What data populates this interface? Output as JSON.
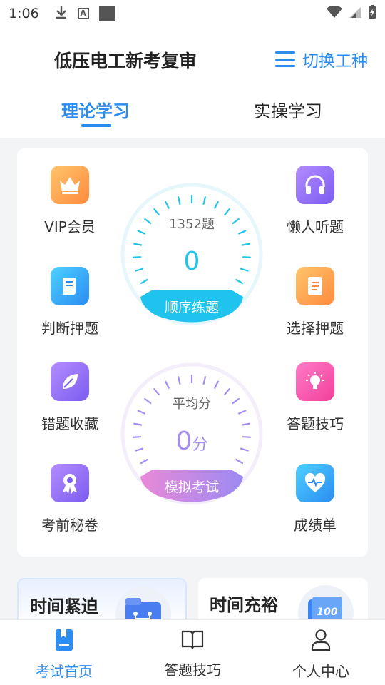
{
  "status_bar": {
    "time": "1:06",
    "left_icons": [
      "download-icon",
      "a-notification-icon",
      "square-notification-icon"
    ],
    "right_icons": [
      "wifi-icon",
      "signal-icon",
      "battery-icon"
    ]
  },
  "header": {
    "title": "低压电工新考复审",
    "switch_label": "切换工种"
  },
  "tabs": [
    {
      "label": "理论学习",
      "active": true
    },
    {
      "label": "实操学习",
      "active": false
    }
  ],
  "features": {
    "vip": "VIP会员",
    "listen": "懒人听题",
    "judge": "判断押题",
    "choice": "选择押题",
    "wrong": "错题收藏",
    "tips": "答题技巧",
    "secret": "考前秘卷",
    "report": "成绩单"
  },
  "gauge_practice": {
    "count": "1352题",
    "value": "0",
    "button": "顺序练题"
  },
  "gauge_exam": {
    "label": "平均分",
    "value": "0",
    "unit": "分",
    "button": "模拟考试"
  },
  "mini_cards": [
    {
      "title": "时间紧迫"
    },
    {
      "title": "时间充裕",
      "badge": "100"
    }
  ],
  "bottom_nav": [
    {
      "label": "考试首页",
      "active": true
    },
    {
      "label": "答题技巧",
      "active": false
    },
    {
      "label": "个人中心",
      "active": false
    }
  ],
  "colors": {
    "accent": "#2d8cf0",
    "gauge_cyan": "#22c5e8",
    "gauge_purple": "#a48cf0"
  }
}
